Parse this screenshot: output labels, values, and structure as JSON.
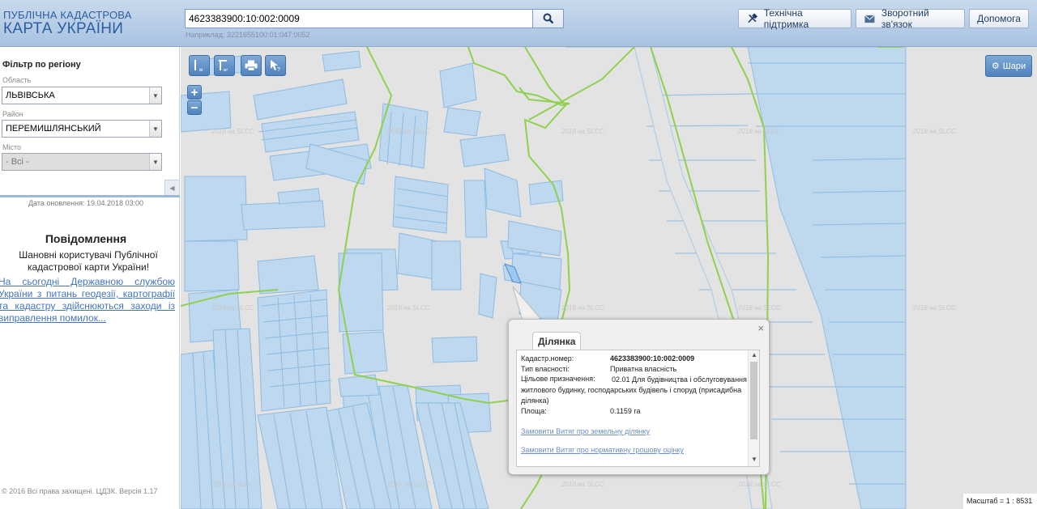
{
  "header": {
    "logo_line1": "ПУБЛІЧНА КАДАСТРОВА",
    "logo_line2": "КАРТА УКРАЇНИ",
    "search_value": "4623383900:10:002:0009",
    "search_hint": "Наприклад: 3221655100:01:047:0052",
    "support_label": "Технічна підтримка",
    "feedback_label": "Зворотний зв'язок",
    "help_label": "Допомога"
  },
  "sidebar": {
    "filter_title": "Фільтр по регіону",
    "oblast_label": "Область",
    "oblast_value": "ЛЬВІВСЬКА",
    "raion_label": "Район",
    "raion_value": "ПЕРЕМИШЛЯНСЬКИЙ",
    "city_label": "Місто",
    "city_value": "- Всі -",
    "update_date": "Дата оновлення: 19.04.2018 03:00",
    "message_title": "Повідомлення",
    "message_body": "Шановні користувачі Публічної кадастрової карти України!",
    "message_link": "На сьогодні Державною службою України з питань геодезії, картографії та кадастру здійснюються заходи із виправлення помилок...",
    "footer": "© 2016 Всі права захищені. ЦДЗК. Версія 1.17"
  },
  "map": {
    "watermark": "2018 на SLCC",
    "zoom_in": "+",
    "zoom_out": "−",
    "layers_label": "Шари",
    "scale_text": "Масштаб = 1 : 8531",
    "colors": {
      "parcel_fill": "#bdd8ef",
      "parcel_stroke": "#8dbbe2",
      "boundary": "#8fd14f",
      "background": "#e3e3e3"
    }
  },
  "popup": {
    "tab_label": "Ділянка",
    "close": "×",
    "fields": [
      {
        "key": "Кадастр.номер:",
        "value": "4623383900:10:002:0009"
      },
      {
        "key": "Тип власності:",
        "value": "Приватна власність"
      }
    ],
    "purpose_key": "Цільове призначення:",
    "purpose_value": "02.01 Для будівництва і обслуговування житлового будинку, господарських будівель і споруд (присадибна ділянка)",
    "area_key": "Площа:",
    "area_value": "0.1159 га",
    "link1": "Замовити Витяг про земельну ділянку",
    "link2": "Замовити Витяг про нормативну грошову оцінку"
  }
}
